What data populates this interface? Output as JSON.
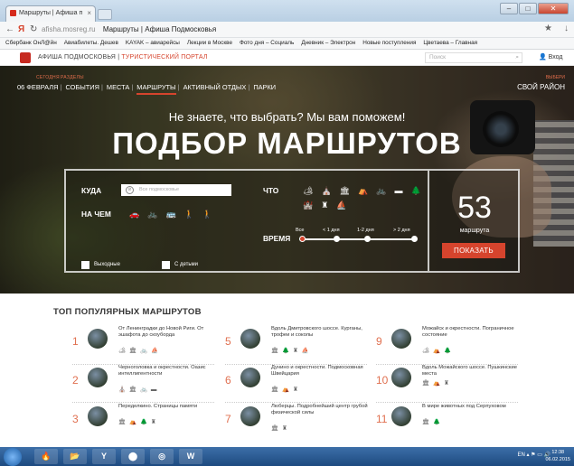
{
  "browser": {
    "tab_title": "Маршруты | Афиша п",
    "tab_close": "×",
    "url_host": "afisha.mosreg.ru",
    "url_title": "Маршруты | Афиша Подмосковья",
    "bookmarks": [
      "Сбербанк ОнЛ@йн",
      "Авиабилеты. Дешев",
      "KAYAK – авиарейсы",
      "Лекции в Москве",
      "Фото дня – Социаль",
      "Дневник – Электрон",
      "Новые поступления",
      "Цветаева – Главная"
    ]
  },
  "site": {
    "name": "АФИША ПОДМОСКОВЬЯ",
    "tour_portal": "ТУРИСТИЧЕСКИЙ ПОРТАЛ",
    "search_placeholder": "Поиск",
    "login": "Вход"
  },
  "hero_nav": {
    "today_small": "СЕГОДНЯ",
    "date": "06 ФЕВРАЛЯ",
    "sections_small": "РАЗДЕЛЫ",
    "items": [
      "СОБЫТИЯ",
      "МЕСТА",
      "МАРШРУТЫ",
      "АКТИВНЫЙ ОТДЫХ",
      "ПАРКИ"
    ],
    "region_small": "ВЫБЕРИ",
    "region": "СВОЙ РАЙОН"
  },
  "hero": {
    "subtitle": "Не знаете, что выбрать? Мы вам поможем!",
    "title": "ПОДБОР МАРШРУТОВ"
  },
  "filter": {
    "where_label": "КУДА",
    "where_placeholder": "Все подмосковье",
    "what_label": "ЧТО",
    "how_label": "НА ЧЕМ",
    "time_label": "ВРЕМЯ",
    "time_options": [
      "Все",
      "< 1 дня",
      "1-2 дня",
      "> 2 дня"
    ],
    "weekends": "Выходные",
    "kids": "С детьми",
    "what_icons_row1": [
      "🏕",
      "⛪",
      "🏛",
      "⛺",
      "🚲",
      "▬",
      "🌲"
    ],
    "what_icons_row2": [
      "🏰",
      "♜",
      "⛵"
    ],
    "how_icons": [
      "🚗",
      "🚲",
      "🚌",
      "🚶",
      "🚶"
    ]
  },
  "result": {
    "count": "53",
    "count_label": "маршрута",
    "show_button": "ПОКАЗАТЬ"
  },
  "popular": {
    "title": "ТОП ПОПУЛЯРНЫХ МАРШРУТОВ",
    "routes": [
      {
        "num": "1",
        "title": "От Ленинградки до Новой Риги. От эшафота до скоуборда",
        "tags": "🏕 🏛 🚲 ⛵"
      },
      {
        "num": "2",
        "title": "Черноголовка и окрестности. Оазис интеллигентности",
        "tags": "⛪ 🏛 🚲 ▬"
      },
      {
        "num": "3",
        "title": "Переделкино. Страницы памяти",
        "tags": "🏛 ⛺ 🌲 ♜"
      },
      {
        "num": "5",
        "title": "Вдоль Дмитровского шоссе. Курганы, трофеи и соколы",
        "tags": "🏛 🌲 ♜ ⛵"
      },
      {
        "num": "6",
        "title": "Дунино и окрестности. Подмосковная Швейцария",
        "tags": "🏛 ⛺ ♜"
      },
      {
        "num": "7",
        "title": "Люберцы. Подробнейший центр грубой физической силы",
        "tags": "🏛 ♜"
      },
      {
        "num": "9",
        "title": "Можайск и окрестности. Пограничное состояние",
        "tags": "🏕 ⛺ 🌲"
      },
      {
        "num": "10",
        "title": "Вдоль Можайского шоссе. Пушкинские места",
        "tags": "🏛 ⛺ ♜"
      },
      {
        "num": "11",
        "title": "В мире животных под Серпуховом",
        "tags": "🏛 🌲"
      }
    ]
  },
  "taskbar": {
    "apps": [
      "🔥",
      "📂",
      "Y",
      "⬤",
      "◎",
      "W"
    ],
    "tray_lang": "EN",
    "time": "12:38",
    "date": "06.02.2015"
  },
  "colors": {
    "accent": "#d6442d",
    "taskbar": "#1d4a80"
  }
}
